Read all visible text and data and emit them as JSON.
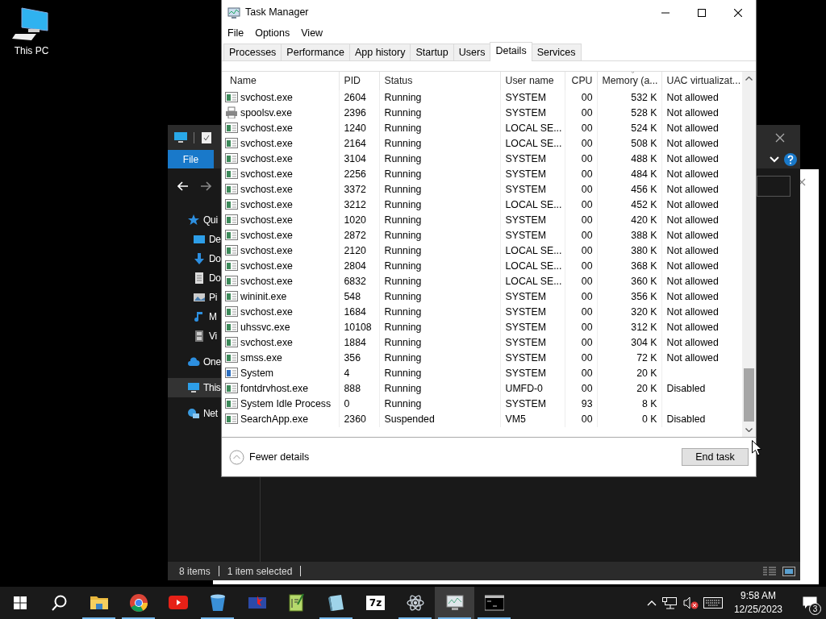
{
  "desktop_icons": [
    {
      "label": "This PC"
    }
  ],
  "explorer": {
    "ribbon_tabs": [
      {
        "label": "File",
        "selected": true
      }
    ],
    "nav_items": [
      {
        "label": "Qui",
        "kind": "star",
        "selected": false,
        "children": [
          {
            "label": "De",
            "kind": "desktop",
            "selected": false
          },
          {
            "label": "Do",
            "kind": "download",
            "selected": false
          },
          {
            "label": "Do",
            "kind": "document",
            "selected": false
          },
          {
            "label": "Pi",
            "kind": "pictures",
            "selected": false
          },
          {
            "label": "M",
            "kind": "music",
            "selected": false
          },
          {
            "label": "Vi",
            "kind": "videos",
            "selected": false
          }
        ]
      },
      {
        "label": "One",
        "kind": "cloud",
        "selected": false
      },
      {
        "label": "This",
        "kind": "pc",
        "selected": true
      },
      {
        "label": "Net",
        "kind": "network",
        "selected": false
      }
    ],
    "status_bar": [
      "8 items",
      "1 item selected"
    ]
  },
  "task_manager": {
    "title": "Task Manager",
    "menu": [
      "File",
      "Options",
      "View"
    ],
    "tabs": [
      {
        "label": "Processes",
        "selected": false
      },
      {
        "label": "Performance",
        "selected": false
      },
      {
        "label": "App history",
        "selected": false
      },
      {
        "label": "Startup",
        "selected": false
      },
      {
        "label": "Users",
        "selected": false
      },
      {
        "label": "Details",
        "selected": true
      },
      {
        "label": "Services",
        "selected": false
      }
    ],
    "columns": [
      {
        "label": "Name",
        "sorted": false
      },
      {
        "label": "PID",
        "sorted": false
      },
      {
        "label": "Status",
        "sorted": false
      },
      {
        "label": "User name",
        "sorted": false
      },
      {
        "label": "CPU",
        "sorted": false
      },
      {
        "label": "Memory (a...",
        "sorted": true
      },
      {
        "label": "UAC virtualizat...",
        "sorted": false
      }
    ],
    "rows": [
      {
        "kind": "service",
        "cells": [
          "svchost.exe",
          "2604",
          "Running",
          "SYSTEM",
          "00",
          "532 K",
          "Not allowed"
        ]
      },
      {
        "kind": "printer",
        "cells": [
          "spoolsv.exe",
          "2396",
          "Running",
          "SYSTEM",
          "00",
          "528 K",
          "Not allowed"
        ]
      },
      {
        "kind": "service",
        "cells": [
          "svchost.exe",
          "1240",
          "Running",
          "LOCAL SE...",
          "00",
          "524 K",
          "Not allowed"
        ]
      },
      {
        "kind": "service",
        "cells": [
          "svchost.exe",
          "2164",
          "Running",
          "LOCAL SE...",
          "00",
          "508 K",
          "Not allowed"
        ]
      },
      {
        "kind": "service",
        "cells": [
          "svchost.exe",
          "3104",
          "Running",
          "SYSTEM",
          "00",
          "488 K",
          "Not allowed"
        ]
      },
      {
        "kind": "service",
        "cells": [
          "svchost.exe",
          "2256",
          "Running",
          "SYSTEM",
          "00",
          "484 K",
          "Not allowed"
        ]
      },
      {
        "kind": "service",
        "cells": [
          "svchost.exe",
          "3372",
          "Running",
          "SYSTEM",
          "00",
          "456 K",
          "Not allowed"
        ]
      },
      {
        "kind": "service",
        "cells": [
          "svchost.exe",
          "3212",
          "Running",
          "LOCAL SE...",
          "00",
          "452 K",
          "Not allowed"
        ]
      },
      {
        "kind": "service",
        "cells": [
          "svchost.exe",
          "1020",
          "Running",
          "SYSTEM",
          "00",
          "420 K",
          "Not allowed"
        ]
      },
      {
        "kind": "service",
        "cells": [
          "svchost.exe",
          "2872",
          "Running",
          "SYSTEM",
          "00",
          "388 K",
          "Not allowed"
        ]
      },
      {
        "kind": "service",
        "cells": [
          "svchost.exe",
          "2120",
          "Running",
          "LOCAL SE...",
          "00",
          "380 K",
          "Not allowed"
        ]
      },
      {
        "kind": "service",
        "cells": [
          "svchost.exe",
          "2804",
          "Running",
          "LOCAL SE...",
          "00",
          "368 K",
          "Not allowed"
        ]
      },
      {
        "kind": "service",
        "cells": [
          "svchost.exe",
          "6832",
          "Running",
          "LOCAL SE...",
          "00",
          "360 K",
          "Not allowed"
        ]
      },
      {
        "kind": "service",
        "cells": [
          "wininit.exe",
          "548",
          "Running",
          "SYSTEM",
          "00",
          "356 K",
          "Not allowed"
        ]
      },
      {
        "kind": "service",
        "cells": [
          "svchost.exe",
          "1684",
          "Running",
          "SYSTEM",
          "00",
          "320 K",
          "Not allowed"
        ]
      },
      {
        "kind": "service",
        "cells": [
          "uhssvc.exe",
          "10108",
          "Running",
          "SYSTEM",
          "00",
          "312 K",
          "Not allowed"
        ]
      },
      {
        "kind": "service",
        "cells": [
          "svchost.exe",
          "1884",
          "Running",
          "SYSTEM",
          "00",
          "304 K",
          "Not allowed"
        ]
      },
      {
        "kind": "service",
        "cells": [
          "smss.exe",
          "356",
          "Running",
          "SYSTEM",
          "00",
          "72 K",
          "Not allowed"
        ]
      },
      {
        "kind": "system",
        "cells": [
          "System",
          "4",
          "Running",
          "SYSTEM",
          "00",
          "20 K"
        ]
      },
      {
        "kind": "service",
        "cells": [
          "fontdrvhost.exe",
          "888",
          "Running",
          "UMFD-0",
          "00",
          "20 K",
          "Disabled"
        ]
      },
      {
        "kind": "service",
        "cells": [
          "System Idle Process",
          "0",
          "Running",
          "SYSTEM",
          "93",
          "8 K"
        ]
      },
      {
        "kind": "service",
        "cells": [
          "SearchApp.exe",
          "2360",
          "Suspended",
          "VM5",
          "00",
          "0 K",
          "Disabled"
        ]
      }
    ],
    "footer": {
      "toggle": "Fewer details",
      "button": "End task"
    }
  },
  "taskbar": {
    "apps": [
      {
        "kind": "start",
        "running": false,
        "active": false
      },
      {
        "kind": "search",
        "running": false,
        "active": false
      },
      {
        "kind": "folder",
        "running": true,
        "active": false
      },
      {
        "kind": "chrome",
        "running": true,
        "active": false
      },
      {
        "kind": "youtube",
        "running": false,
        "active": false
      },
      {
        "kind": "bin",
        "running": true,
        "active": false
      },
      {
        "kind": "flag",
        "running": false,
        "active": false
      },
      {
        "kind": "notepad",
        "running": false,
        "active": false
      },
      {
        "kind": "pad",
        "running": true,
        "active": false
      },
      {
        "kind": "sevenzip",
        "running": false,
        "active": false,
        "text": "7z"
      },
      {
        "kind": "atom",
        "running": true,
        "active": false
      },
      {
        "kind": "monitor",
        "running": true,
        "active": true
      },
      {
        "kind": "terminal",
        "running": true,
        "active": false
      }
    ],
    "time": "9:58 AM",
    "date": "12/25/2023",
    "notifications": "3"
  }
}
